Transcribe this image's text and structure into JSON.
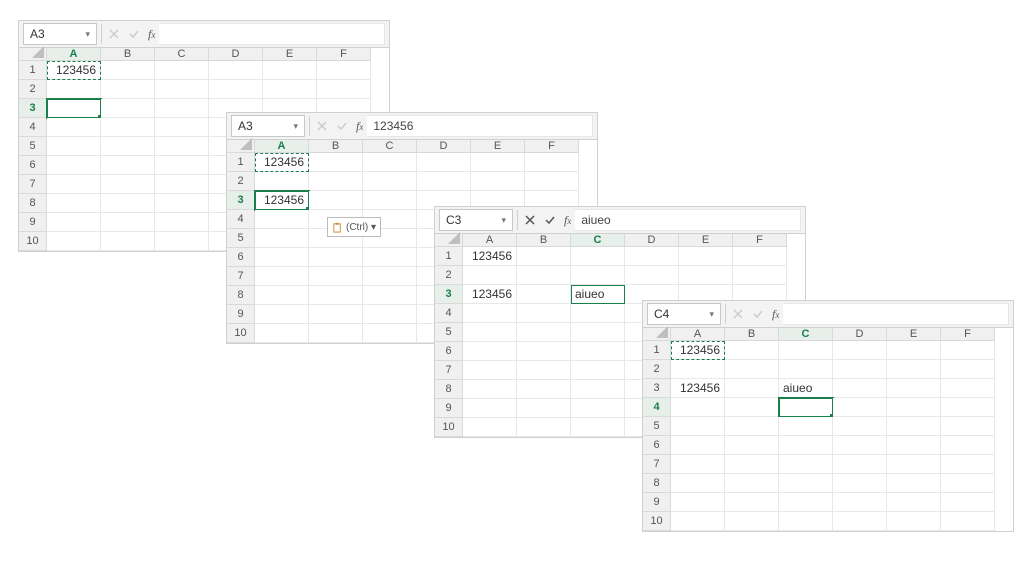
{
  "columns": [
    "A",
    "B",
    "C",
    "D",
    "E",
    "F"
  ],
  "rows": [
    "1",
    "2",
    "3",
    "4",
    "5",
    "6",
    "7",
    "8",
    "9",
    "10"
  ],
  "panel1": {
    "name_box": "A3",
    "formula": "",
    "cells": {
      "A1": "123456"
    },
    "marching": "A1",
    "selected": "A3",
    "col_hi": "A",
    "row_hi": "3"
  },
  "panel2": {
    "name_box": "A3",
    "formula": "123456",
    "cells": {
      "A1": "123456",
      "A3": "123456"
    },
    "marching": "A1",
    "selected": "A3",
    "col_hi": "A",
    "row_hi": "3",
    "paste_label": "(Ctrl) ▾"
  },
  "panel3": {
    "name_box": "C3",
    "formula": "aiueo",
    "cells": {
      "A1": "123456",
      "A3": "123456",
      "C3": "aiueo"
    },
    "editing": "C3",
    "col_hi": "C",
    "row_hi": "3"
  },
  "panel4": {
    "name_box": "C4",
    "formula": "",
    "cells": {
      "A1": "123456",
      "A3": "123456",
      "C3": "aiueo"
    },
    "marching": "A1",
    "selected": "C4",
    "col_hi": "C",
    "row_hi": "4"
  },
  "icons": {
    "cancel": "cancel-icon",
    "accept": "accept-icon",
    "fx": "fx-icon",
    "dropdown": "chevron-down-icon",
    "clipboard": "clipboard-icon"
  }
}
